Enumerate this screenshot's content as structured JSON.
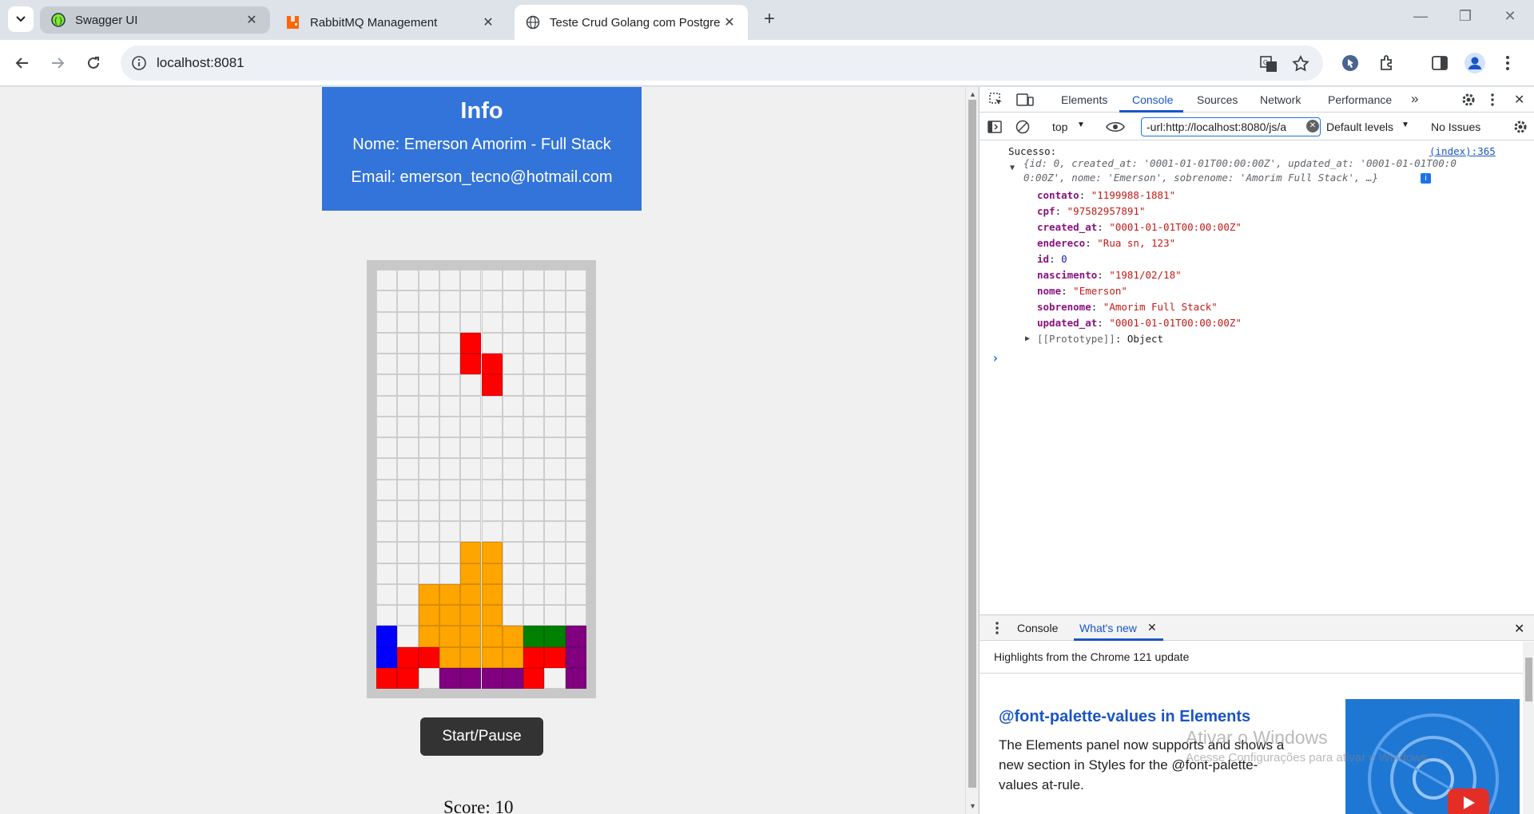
{
  "browser": {
    "tabs": [
      {
        "title": "Swagger UI",
        "favicon": "swagger-icon",
        "active": false
      },
      {
        "title": "RabbitMQ Management",
        "favicon": "rabbitmq-icon",
        "active": false
      },
      {
        "title": "Teste Crud Golang com Postgre",
        "favicon": "globe-icon",
        "active": true
      }
    ],
    "url": "localhost:8081"
  },
  "page": {
    "info": {
      "title": "Info",
      "nome": "Nome: Emerson Amorim - Full Stack",
      "email": "Email: emerson_tecno@hotmail.com"
    },
    "start_button": "Start/Pause",
    "score": "Score: 10",
    "tetris": {
      "columns": 10,
      "rows": 20,
      "colors": {
        "r": "#ff0000",
        "o": "#ffa500",
        "b": "#0000ff",
        "g": "#008000",
        "p": "#800080"
      },
      "board": [
        "..........",
        "..........",
        "..........",
        "....r.....",
        "....rr....",
        ".....r....",
        "..........",
        "..........",
        "..........",
        "..........",
        "..........",
        "..........",
        "..........",
        "....oo....",
        "....oo....",
        "..oooo....",
        "..oooo....",
        "b.oooooggp",
        "brroooorrp",
        "rr.ppppr.p"
      ]
    }
  },
  "devtools": {
    "tabs": [
      "Elements",
      "Console",
      "Sources",
      "Network",
      "Performance"
    ],
    "active_tab": "Console",
    "context": "top",
    "filter": "-url:http://localhost:8080/js/a",
    "levels": "Default levels",
    "issues": "No Issues",
    "console": {
      "message": "Sucesso:",
      "source": "(index):365",
      "summary_line1": "{id: 0, created_at: '0001-01-01T00:00:00Z', updated_at: '0001-01-01T00:0",
      "summary_line2": "0:00Z', nome: 'Emerson', sobrenome: 'Amorim Full Stack', …}",
      "props": [
        {
          "key": "contato",
          "value": "\"1199988-1881\"",
          "type": "str"
        },
        {
          "key": "cpf",
          "value": "\"97582957891\"",
          "type": "str"
        },
        {
          "key": "created_at",
          "value": "\"0001-01-01T00:00:00Z\"",
          "type": "str"
        },
        {
          "key": "endereco",
          "value": "\"Rua sn, 123\"",
          "type": "str"
        },
        {
          "key": "id",
          "value": "0",
          "type": "num"
        },
        {
          "key": "nascimento",
          "value": "\"1981/02/18\"",
          "type": "str"
        },
        {
          "key": "nome",
          "value": "\"Emerson\"",
          "type": "str"
        },
        {
          "key": "sobrenome",
          "value": "\"Amorim Full Stack\"",
          "type": "str"
        },
        {
          "key": "updated_at",
          "value": "\"0001-01-01T00:00:00Z\"",
          "type": "str"
        }
      ],
      "prototype": "[[Prototype]]",
      "prototype_value": "Object",
      "prompt": "›"
    },
    "drawer": {
      "tabs": [
        "Console",
        "What's new"
      ],
      "active_tab": "What's new",
      "highlights": "Highlights from the Chrome 121 update",
      "heading": "@font-palette-values in Elements",
      "text": "The Elements panel now supports and shows a new section in Styles for the @font-palette-values at-rule."
    },
    "watermark": {
      "line1": "Ativar o Windows",
      "line2": "Acesse Configurações para ativar o Windows."
    }
  }
}
